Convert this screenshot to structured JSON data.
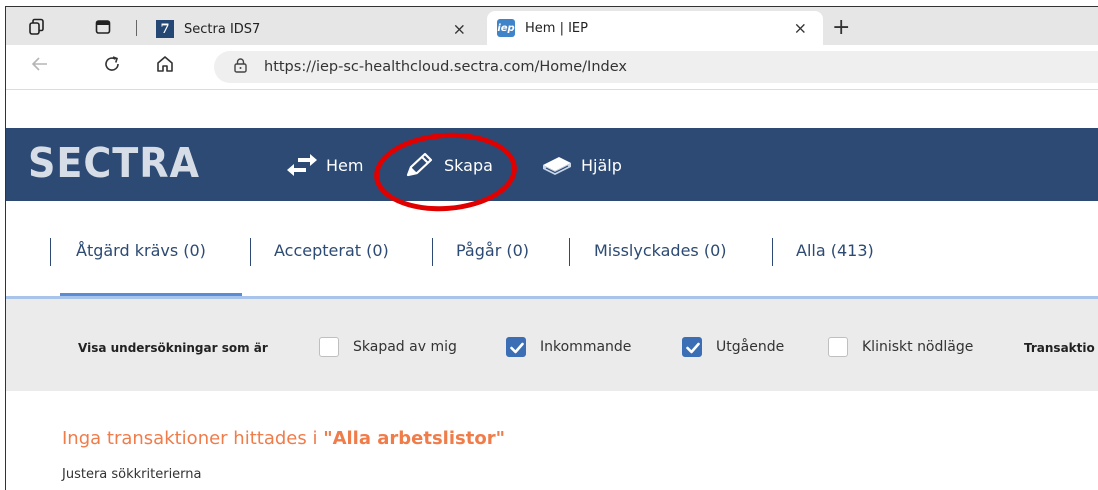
{
  "browser": {
    "tabs": [
      {
        "title": "Sectra IDS7",
        "favicon": "sectra-7-favicon"
      },
      {
        "title": "Hem | IEP",
        "favicon": "iep-favicon"
      }
    ],
    "favicon_sectra_text": "7",
    "favicon_iep_text": "iep",
    "close_glyph": "×",
    "newtab_glyph": "+",
    "url": "https://iep-sc-healthcloud.sectra.com/Home/Index"
  },
  "app": {
    "logo": "SECTRA",
    "nav": [
      {
        "label": "Hem",
        "icon": "swap-arrows-icon"
      },
      {
        "label": "Skapa",
        "icon": "pencil-icon"
      },
      {
        "label": "Hjälp",
        "icon": "book-icon"
      }
    ],
    "highlight_color": "#e10000",
    "header_color": "#2c4a73"
  },
  "worklist_tabs": [
    {
      "label": "Åtgärd krävs (0)",
      "active": true
    },
    {
      "label": "Accepterat (0)",
      "active": false
    },
    {
      "label": "Pågår (0)",
      "active": false
    },
    {
      "label": "Misslyckades (0)",
      "active": false
    },
    {
      "label": "Alla (413)",
      "active": false
    }
  ],
  "filters": {
    "label": "Visa undersökningar som är",
    "options": [
      {
        "label": "Skapad av mig",
        "checked": false
      },
      {
        "label": "Inkommande",
        "checked": true
      },
      {
        "label": "Utgående",
        "checked": true
      },
      {
        "label": "Kliniskt nödläge",
        "checked": false
      }
    ],
    "trailing_label": "Transaktio"
  },
  "results": {
    "message_prefix": "Inga transaktioner hittades i ",
    "message_highlight": "\"Alla arbetslistor\"",
    "hint": "Justera sökkriterierna"
  }
}
